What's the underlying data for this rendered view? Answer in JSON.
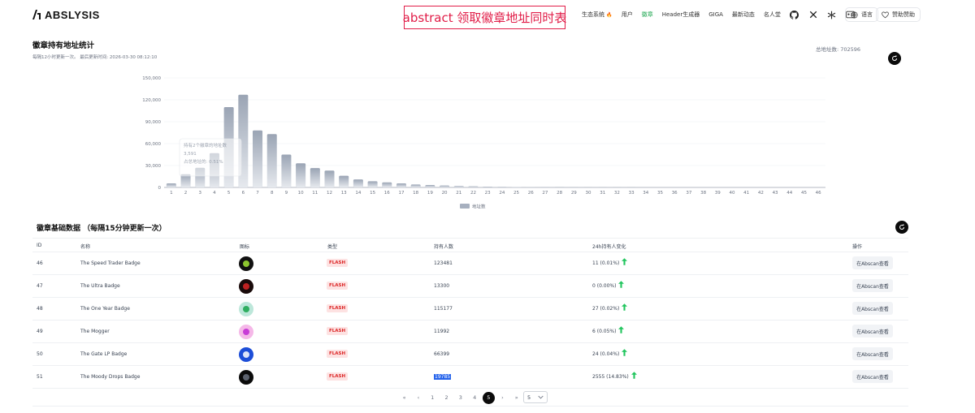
{
  "header": {
    "logo_text": "ABSLYSIS",
    "banner": "abstract 领取徽章地址同时表",
    "nav": [
      {
        "label": "生态系统",
        "active": false,
        "suffix": "🔥"
      },
      {
        "label": "用户",
        "active": false
      },
      {
        "label": "徽章",
        "active": true
      },
      {
        "label": "Header生成器",
        "active": false
      },
      {
        "label": "GIGA",
        "active": false
      },
      {
        "label": "最新动态",
        "active": false
      },
      {
        "label": "名人堂",
        "active": false
      }
    ],
    "icons": [
      "github-icon",
      "x-icon",
      "network-icon",
      "id-card-icon"
    ],
    "language_label": "语言",
    "sponsor_label": "赞助赞助"
  },
  "chart_section": {
    "title": "徽章持有地址统计",
    "subtitle": "每隔12小时更新一次。 最后更新时间: 2026-03-30 08:12:10",
    "total_label": "总地址数: 702596"
  },
  "chart_data": {
    "type": "bar",
    "categories": [
      "1",
      "2",
      "3",
      "4",
      "5",
      "6",
      "7",
      "8",
      "9",
      "10",
      "11",
      "12",
      "13",
      "14",
      "15",
      "16",
      "17",
      "18",
      "19",
      "20",
      "21",
      "22",
      "23",
      "24",
      "25",
      "26",
      "27",
      "28",
      "29",
      "30",
      "31",
      "32",
      "33",
      "34",
      "35",
      "36",
      "37",
      "38",
      "39",
      "40",
      "41",
      "42",
      "43",
      "44",
      "45",
      "46"
    ],
    "series": [
      {
        "name": "地址数",
        "values": [
          5500,
          18000,
          27000,
          47000,
          110000,
          127000,
          78000,
          73000,
          45000,
          33000,
          26500,
          23000,
          16000,
          11000,
          8500,
          7000,
          5500,
          4000,
          3300,
          2600,
          2000,
          1500,
          1100,
          800,
          600,
          450,
          350,
          250,
          200,
          150,
          120,
          100,
          80,
          60,
          50,
          40,
          30,
          25,
          20,
          15,
          12,
          10,
          8,
          6,
          5,
          4
        ]
      }
    ],
    "yticks": [
      "0",
      "30,000",
      "60,000",
      "90,000",
      "120,000",
      "150,000"
    ],
    "ylim": [
      0,
      150000
    ],
    "grid": true,
    "legend": "bottom-center",
    "tooltip_lines": [
      "持有2个徽章的地址数",
      "3,591",
      "占总地址的: 0.51%"
    ]
  },
  "table": {
    "title": "徽章基础数据 （每隔15分钟更新一次）",
    "columns": [
      "ID",
      "名称",
      "图标",
      "类型",
      "持有人数",
      "24h持有人变化",
      "操作"
    ],
    "rows": [
      {
        "id": "46",
        "name": "The Speed Trader Badge",
        "type": "FLASH",
        "holders": "123481",
        "change": "11 (0.01%)",
        "action": "在Abscan查看",
        "icon_color": "#111111",
        "icon_accent": "#a3e635"
      },
      {
        "id": "47",
        "name": "The Ultra Badge",
        "type": "FLASH",
        "holders": "13300",
        "change": "0 (0.00%)",
        "action": "在Abscan查看",
        "icon_color": "#1a0b0b",
        "icon_accent": "#dc2626"
      },
      {
        "id": "48",
        "name": "The One Year Badge",
        "type": "FLASH",
        "holders": "115177",
        "change": "27 (0.02%)",
        "action": "在Abscan查看",
        "icon_color": "#bde7da",
        "icon_accent": "#16a34a"
      },
      {
        "id": "49",
        "name": "The Mogger",
        "type": "FLASH",
        "holders": "11992",
        "change": "6 (0.05%)",
        "action": "在Abscan查看",
        "icon_color": "#f5b8e8",
        "icon_accent": "#c026d3"
      },
      {
        "id": "50",
        "name": "The Gate LP Badge",
        "type": "FLASH",
        "holders": "66399",
        "change": "24 (0.04%)",
        "action": "在Abscan查看",
        "icon_color": "#1d4ed8",
        "icon_accent": "#ffffff"
      },
      {
        "id": "51",
        "name": "The Moody Drops Badge",
        "type": "FLASH",
        "holders": "19785",
        "change": "2555 (14.83%)",
        "action": "在Abscan查看",
        "icon_color": "#0b0b0b",
        "icon_accent": "#6b7280"
      }
    ]
  },
  "pagination": {
    "first": "«",
    "prev": "‹",
    "pages": [
      "1",
      "2",
      "3",
      "4",
      "5"
    ],
    "current": "5",
    "next": "›",
    "last": "»",
    "page_size": "5"
  },
  "colors": {
    "bar_top": "#9aa4b4",
    "bar_bottom": "#e6e9ee",
    "trend_up": "#22c55e",
    "active_nav": "#16a34a"
  }
}
